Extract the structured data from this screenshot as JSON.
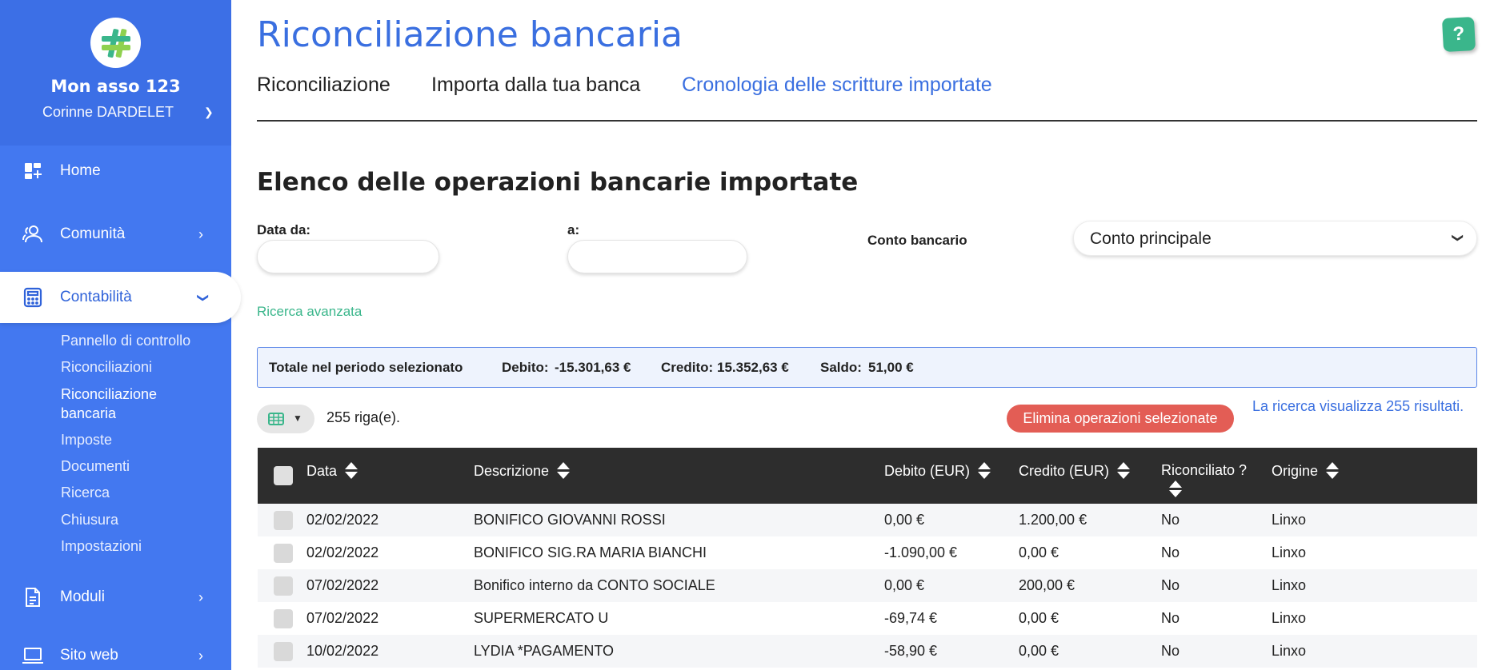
{
  "sidebar": {
    "org_name": "Mon asso 123",
    "user_name": "Corinne DARDELET",
    "items": [
      {
        "label": "Home",
        "icon": "dashboard-icon"
      },
      {
        "label": "Comunità",
        "icon": "users-icon"
      },
      {
        "label": "Contabilità",
        "icon": "calculator-icon"
      },
      {
        "label": "Moduli",
        "icon": "document-icon"
      },
      {
        "label": "Sito web",
        "icon": "laptop-icon"
      }
    ],
    "subitems": [
      "Pannello di controllo",
      "Riconciliazioni",
      "Riconciliazione",
      "bancaria",
      "Imposte",
      "Documenti",
      "Ricerca",
      "Chiusura",
      "Impostazioni"
    ]
  },
  "header": {
    "title": "Riconciliazione bancaria",
    "help_label": "?"
  },
  "tabs": [
    {
      "label": "Riconciliazione"
    },
    {
      "label": "Importa dalla tua banca"
    },
    {
      "label": "Cronologia delle scritture importate"
    }
  ],
  "main": {
    "section_title": "Elenco delle operazioni bancarie importate",
    "filters": {
      "date_from_label": "Data da:",
      "date_from_value": "",
      "date_to_label": "a:",
      "date_to_value": "",
      "account_label": "Conto bancario",
      "account_value": "Conto principale"
    },
    "advanced_search": "Ricerca avanzata",
    "totals": {
      "label": "Totale nel periodo selezionato",
      "debit_label": "Debito:",
      "debit_value": "-15.301,63 €",
      "credit_label": "Credito:",
      "credit_value": "15.352,63 €",
      "balance_label": "Saldo:",
      "balance_value": "51,00 €"
    },
    "row_count": "255 riga(e).",
    "delete_label": "Elimina operazioni selezionate",
    "results_info": "La ricerca visualizza 255 risultati."
  },
  "table": {
    "columns": [
      "Data",
      "Descrizione",
      "Debito (EUR)",
      "Credito (EUR)",
      "Riconciliato ?",
      "Origine"
    ],
    "rows": [
      [
        "02/02/2022",
        "BONIFICO GIOVANNI ROSSI",
        "0,00 €",
        "1.200,00 €",
        "No",
        "Linxo"
      ],
      [
        "02/02/2022",
        "BONIFICO SIG.RA MARIA BIANCHI",
        "-1.090,00 €",
        "0,00 €",
        "No",
        "Linxo"
      ],
      [
        "07/02/2022",
        "Bonifico interno da CONTO SOCIALE",
        "0,00 €",
        "200,00 €",
        "No",
        "Linxo"
      ],
      [
        "07/02/2022",
        "SUPERMERCATO U",
        "-69,74 €",
        "0,00 €",
        "No",
        "Linxo"
      ],
      [
        "10/02/2022",
        "LYDIA *PAGAMENTO",
        "-58,90 €",
        "0,00 €",
        "No",
        "Linxo"
      ]
    ]
  },
  "colors": {
    "sidebar": "#4378f0",
    "accent": "#3a6fe0",
    "green": "#3ab68b",
    "danger": "#e35d55",
    "table_header": "#2d2d2d"
  }
}
